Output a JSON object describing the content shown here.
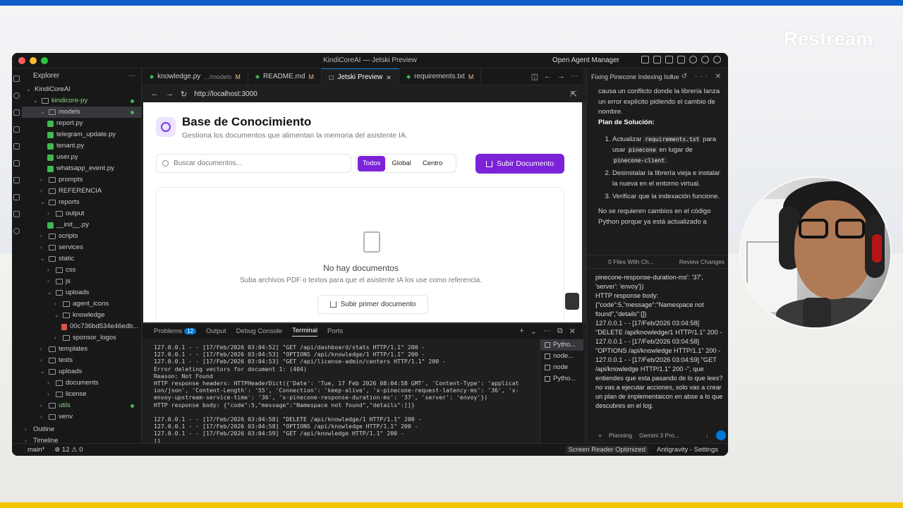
{
  "overlay": {
    "brand": "Restream"
  },
  "window": {
    "title": "KindiCoreAI — Jetski Preview",
    "open_agent_manager": "Open Agent Manager"
  },
  "explorer": {
    "header": "Explorer",
    "tree": [
      {
        "label": "KindiCoreAI",
        "indent": 0,
        "kind": "root",
        "chev": "⌄"
      },
      {
        "label": "kindicore-py",
        "indent": 1,
        "kind": "folder",
        "chev": "⌄",
        "green": true,
        "dot": true
      },
      {
        "label": "models",
        "indent": 2,
        "kind": "folder",
        "chev": "⌄",
        "dot": true,
        "selected": true
      },
      {
        "label": "report.py",
        "indent": 3,
        "kind": "py"
      },
      {
        "label": "telegram_update.py",
        "indent": 3,
        "kind": "py"
      },
      {
        "label": "tenant.py",
        "indent": 3,
        "kind": "py"
      },
      {
        "label": "user.py",
        "indent": 3,
        "kind": "py"
      },
      {
        "label": "whatsapp_event.py",
        "indent": 3,
        "kind": "py"
      },
      {
        "label": "prompts",
        "indent": 2,
        "kind": "folder",
        "chev": "›"
      },
      {
        "label": "REFERENCIA",
        "indent": 2,
        "kind": "folder",
        "chev": "›"
      },
      {
        "label": "reports",
        "indent": 2,
        "kind": "folder",
        "chev": "⌄"
      },
      {
        "label": "output",
        "indent": 3,
        "kind": "folder",
        "chev": "›"
      },
      {
        "label": "__init__.py",
        "indent": 3,
        "kind": "py"
      },
      {
        "label": "scripts",
        "indent": 2,
        "kind": "folder",
        "chev": "›"
      },
      {
        "label": "services",
        "indent": 2,
        "kind": "folder",
        "chev": "›"
      },
      {
        "label": "static",
        "indent": 2,
        "kind": "folder",
        "chev": "⌄"
      },
      {
        "label": "css",
        "indent": 3,
        "kind": "folder",
        "chev": "›"
      },
      {
        "label": "js",
        "indent": 3,
        "kind": "folder",
        "chev": "›"
      },
      {
        "label": "uploads",
        "indent": 3,
        "kind": "folder",
        "chev": "⌄"
      },
      {
        "label": "agent_icons",
        "indent": 4,
        "kind": "folder",
        "chev": "›"
      },
      {
        "label": "knowledge",
        "indent": 4,
        "kind": "folder",
        "chev": "⌄"
      },
      {
        "label": "00c736bd534e46edb...",
        "indent": 5,
        "kind": "pdf"
      },
      {
        "label": "sponsor_logos",
        "indent": 4,
        "kind": "folder",
        "chev": "›"
      },
      {
        "label": "templates",
        "indent": 2,
        "kind": "folder",
        "chev": "›"
      },
      {
        "label": "tests",
        "indent": 2,
        "kind": "folder",
        "chev": "›"
      },
      {
        "label": "uploads",
        "indent": 2,
        "kind": "folder",
        "chev": "⌄"
      },
      {
        "label": "documents",
        "indent": 3,
        "kind": "folder",
        "chev": "›"
      },
      {
        "label": "license",
        "indent": 3,
        "kind": "folder",
        "chev": "›"
      },
      {
        "label": "utils",
        "indent": 2,
        "kind": "folder",
        "chev": "›",
        "green": true,
        "dot": true
      },
      {
        "label": "venv",
        "indent": 2,
        "kind": "folder",
        "chev": "›"
      }
    ],
    "outline": "Outline",
    "timeline": "Timeline"
  },
  "tabs": [
    {
      "label": "knowledge.py",
      "sub": ".../models",
      "mod": "M"
    },
    {
      "label": "README.md",
      "sub": "",
      "mod": "M"
    },
    {
      "label": "Jetski Preview",
      "sub": "",
      "mod": "✕",
      "active": true
    },
    {
      "label": "requirements.txt",
      "sub": "",
      "mod": "M"
    }
  ],
  "browser": {
    "url": "http://localhost:3000"
  },
  "app": {
    "title": "Base de Conocimiento",
    "subtitle": "Gestiona los documentos que alimentan la memoria del asistente IA.",
    "search_placeholder": "Buscar documentos...",
    "filters": [
      "Todos",
      "Global",
      "Centro"
    ],
    "upload_label": "Subir Documento",
    "empty_title": "No hay documentos",
    "empty_sub": "Suba archivos PDF o textos para que el asistente IA los use como referencia.",
    "first_upload": "Subir primer documento"
  },
  "panel": {
    "tabs": [
      "Problems",
      "Output",
      "Debug Console",
      "Terminal",
      "Ports"
    ],
    "problems_count": "12",
    "terminal_lines": [
      "127.0.0.1 - - [17/Feb/2026 03:04:52] \"GET /api/dashboard/stats HTTP/1.1\" 200 -",
      "127.0.0.1 - - [17/Feb/2026 03:04:53] \"OPTIONS /api/knowledge/1 HTTP/1.1\" 200 -",
      "127.0.0.1 - - [17/Feb/2026 03:04:53] \"GET /api/license-admin/centers HTTP/1.1\" 200 -",
      "Error deleting vectors for document 1: (404)",
      "Reason: Not Found",
      "HTTP response headers: HTTPHeaderDict({'Date': 'Tue, 17 Feb 2026 08:04:58 GMT', 'Content-Type': 'applicat",
      "ion/json', 'Content-Length': '55', 'Connection': 'keep-alive', 'x-pinecone-request-latency-ms': '36', 'x-",
      "envoy-upstream-service-time': '36', 'x-pinecone-response-duration-ms': '37', 'server': 'envoy'})",
      "HTTP response body: {\"code\":5,\"message\":\"Namespace not found\",\"details\":[]}",
      "",
      "127.0.0.1 - - [17/Feb/2026 03:04:58] \"DELETE /api/knowledge/1 HTTP/1.1\" 200 -",
      "127.0.0.1 - - [17/Feb/2026 03:04:58] \"OPTIONS /api/knowledge HTTP/1.1\" 200 -",
      "127.0.0.1 - - [17/Feb/2026 03:04:59] \"GET /api/knowledge HTTP/1.1\" 200 -",
      "[]"
    ],
    "terminal_instances": [
      "Pytho...",
      "node...",
      "node",
      "Pytho..."
    ]
  },
  "agent": {
    "header": "Fixing Pinecone Indexing Issue",
    "intro": "causa un conflicto donde la librería lanza un error explícito pidiendo el cambio de nombre.",
    "plan_title": "Plan de Solución:",
    "step1_pre": "Actualizar",
    "step1_code1": "requirements.txt",
    "step1_mid": "para usar",
    "step1_code2": "pinecone",
    "step1_mid2": "en lugar de",
    "step1_code3": "pinecone-client",
    "step2": "Desinstalar la librería vieja e instalar la nueva en el entorno virtual.",
    "step3": "Verificar que la indexación funcione.",
    "closing": "No se requieren cambios en el código Python porque ya está actualizado a",
    "files_changed": "0 Files With Ch...",
    "review": "Review Changes",
    "input_text": "pinecone-response-duration-ms': '37', 'server': 'envoy'})\nHTTP response body:\n{\"code\":5,\"message\":\"Namespace not found\",\"details\":[]}\n\n127.0.0.1 - - [17/Feb/2026 03:04:58] \"DELETE /api/knowledge/1 HTTP/1.1\" 200 -\n127.0.0.1 - - [17/Feb/2026 03:04:58] \"OPTIONS /api/knowledge HTTP/1.1\" 200 -\n127.0.0.1 - - [17/Feb/2026 03:04:59] \"GET /api/knowledge HTTP/1.1\" 200 -\", que entiendes que esta pasando de lo que lees? no vas a ejecutar acciones, solo vas a crear un plan de implementaicon en abse a lo que descubres en el log.",
    "mode": "Planning",
    "model": "Gemini 3 Pro..."
  },
  "status": {
    "branch": "main*",
    "errors": "12",
    "warnings": "0",
    "screen_reader": "Screen Reader Optimized",
    "antigravity": "Antigravity - Settings"
  },
  "colors": {
    "accent": "#7c22d8",
    "vscode_blue": "#0078d4"
  }
}
